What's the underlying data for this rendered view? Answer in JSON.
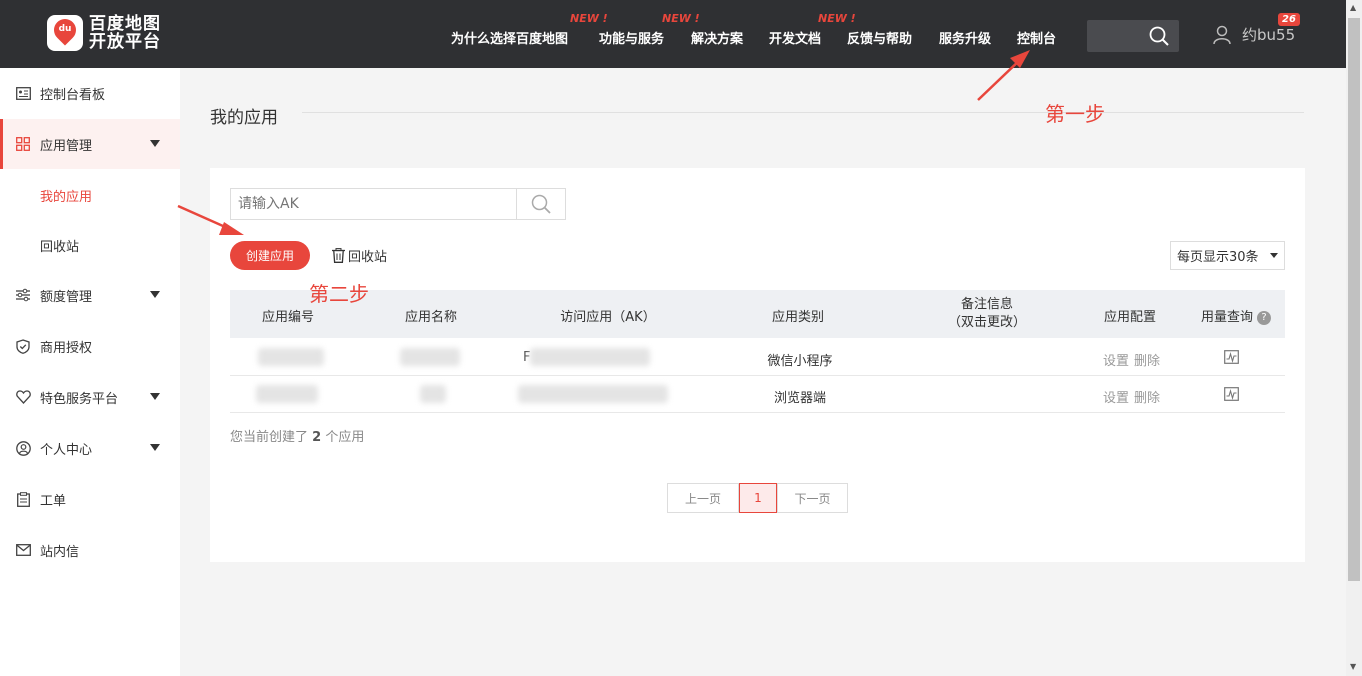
{
  "brand": {
    "line1": "百度地图",
    "line2": "开放平台",
    "mark": "du"
  },
  "nav": {
    "items": [
      {
        "label": "为什么选择百度地图",
        "new": ""
      },
      {
        "label": "功能与服务",
        "new": "NEW !"
      },
      {
        "label": "解决方案",
        "new": "NEW !"
      },
      {
        "label": "开发文档",
        "new": ""
      },
      {
        "label": "反馈与帮助",
        "new": "NEW !"
      },
      {
        "label": "服务升级",
        "new": ""
      },
      {
        "label": "控制台",
        "new": ""
      }
    ],
    "user": "约bu55",
    "badge": "26"
  },
  "sidebar": {
    "items": [
      {
        "label": "控制台看板",
        "icon": "dashboard-icon"
      },
      {
        "label": "应用管理",
        "icon": "grid-icon"
      },
      {
        "label": "额度管理",
        "icon": "sliders-icon"
      },
      {
        "label": "商用授权",
        "icon": "shield-icon"
      },
      {
        "label": "特色服务平台",
        "icon": "heart-shield-icon"
      },
      {
        "label": "个人中心",
        "icon": "user-circle-icon"
      },
      {
        "label": "工单",
        "icon": "clipboard-icon"
      },
      {
        "label": "站内信",
        "icon": "mail-icon"
      }
    ],
    "sub": {
      "my_apps": "我的应用",
      "recycle": "回收站"
    }
  },
  "main": {
    "title": "我的应用",
    "search_placeholder": "请输入AK",
    "create_label": "创建应用",
    "recycle_label": "回收站",
    "page_size": "每页显示30条",
    "columns": {
      "id": "应用编号",
      "name": "应用名称",
      "ak": "访问应用（AK）",
      "type": "应用类别",
      "note1": "备注信息",
      "note2": "（双击更改）",
      "config": "应用配置",
      "usage": "用量查询"
    },
    "rows": [
      {
        "ak_prefix": "F",
        "type": "微信小程序",
        "set": "设置",
        "del": "删除"
      },
      {
        "ak_prefix": "",
        "type": "浏览器端",
        "set": "设置",
        "del": "删除"
      }
    ],
    "count_prefix": "您当前创建了",
    "count_value": "2",
    "count_suffix": "个应用",
    "pager": {
      "prev": "上一页",
      "current": "1",
      "next": "下一页"
    }
  },
  "annotations": {
    "step1": "第一步",
    "step2": "第二步"
  },
  "colors": {
    "accent": "#e8463c",
    "topbar": "#2f3033"
  }
}
